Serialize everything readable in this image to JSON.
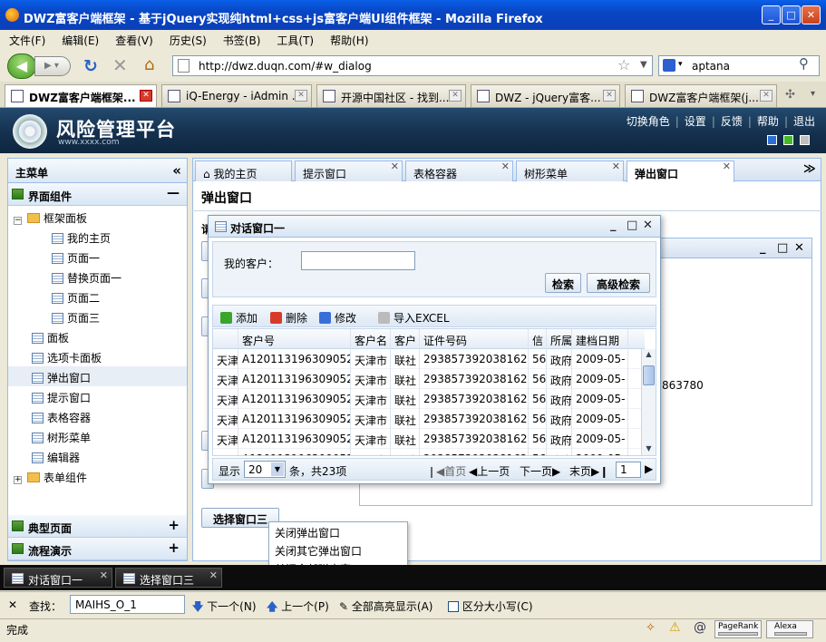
{
  "window": {
    "title": "DWZ富客户端框架 - 基于jQuery实现纯html+css+js富客户端UI组件框架 - Mozilla Firefox"
  },
  "menubar": [
    "文件(F)",
    "编辑(E)",
    "查看(V)",
    "历史(S)",
    "书签(B)",
    "工具(T)",
    "帮助(H)"
  ],
  "navbar": {
    "url": "http://dwz.duqn.com/#w_dialog",
    "search_value": "aptana"
  },
  "browser_tabs": [
    "DWZ富客户端框架...",
    "iQ-Energy - iAdmin ...",
    "开源中国社区 - 找到...",
    "DWZ - jQuery富客...",
    "DWZ富客户端框架(j..."
  ],
  "header": {
    "title": "风险管理平台",
    "url_text": "www.xxxx.com",
    "links": [
      "切换角色",
      "设置",
      "反馈",
      "帮助",
      "退出"
    ],
    "swatch_colors": [
      "#2e6fd6",
      "#45b82c",
      "#c0c0c0"
    ]
  },
  "sidebar": {
    "title": "主菜单",
    "sections": [
      "界面组件",
      "典型页面",
      "流程演示"
    ],
    "tree": {
      "group_label": "框架面板",
      "group_children": [
        "我的主页",
        "页面一",
        "替换页面一",
        "页面二",
        "页面三"
      ],
      "items": [
        "面板",
        "选项卡面板",
        "弹出窗口",
        "提示窗口",
        "表格容器",
        "树形菜单",
        "编辑器"
      ],
      "form_group": "表单组件"
    }
  },
  "main_tabs": [
    "我的主页",
    "提示窗口",
    "表格容器",
    "树形菜单",
    "弹出窗口"
  ],
  "page": {
    "title": "弹出窗口",
    "bg_fragment_top": "请",
    "select_button": "选择窗口三",
    "partial_number": "863780"
  },
  "dialog": {
    "title": "对话窗口一",
    "search_label": "我的客户：",
    "search_value": "",
    "btn_search": "检索",
    "btn_advanced": "高级检索",
    "toolbar": [
      "添加",
      "删除",
      "修改",
      "导入EXCEL"
    ],
    "columns": [
      "",
      "客户号",
      "客户名",
      "客户",
      "证件号码",
      "信",
      "所属",
      "建档日期"
    ],
    "rows": [
      [
        "天津",
        "A120113196309052",
        "天津市",
        "联社",
        "293857392038162",
        "56",
        "政府",
        "2009-05-"
      ],
      [
        "天津",
        "A120113196309052",
        "天津市",
        "联社",
        "293857392038162",
        "56",
        "政府",
        "2009-05-"
      ],
      [
        "天津",
        "A120113196309052",
        "天津市",
        "联社",
        "293857392038162",
        "56",
        "政府",
        "2009-05-"
      ],
      [
        "天津",
        "A120113196309052",
        "天津市",
        "联社",
        "293857392038162",
        "56",
        "政府",
        "2009-05-"
      ],
      [
        "天津",
        "A120113196309052",
        "天津市",
        "联社",
        "293857392038162",
        "56",
        "政府",
        "2009-05-"
      ],
      [
        "天津",
        "A120113196309052",
        "天津市",
        "联社",
        "293857392038162",
        "56",
        "政府",
        "2009-05-"
      ]
    ],
    "pager": {
      "show_label": "显示",
      "page_size": "20",
      "total_text": "条，共23项",
      "first": "首页",
      "prev": "上一页",
      "next": "下一页",
      "last": "末页",
      "page_value": "1"
    }
  },
  "context_menu": [
    "关闭弹出窗口",
    "关闭其它弹出窗口",
    "关闭全部弹出窗口"
  ],
  "taskbar": [
    "对话窗口一",
    "选择窗口三"
  ],
  "findbar": {
    "label": "查找：",
    "value": "MAIHS_O_1",
    "next": "下一个(N)",
    "prev": "上一个(P)",
    "highlight": "全部高亮显示(A)",
    "match_case": "区分大小写(C)"
  },
  "statusbar": {
    "text": "完成",
    "pagerank": "PageRank",
    "alexa": "Alexa"
  }
}
